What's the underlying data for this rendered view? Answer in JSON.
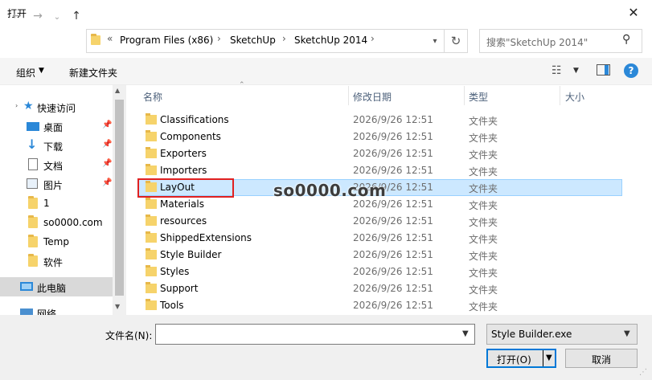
{
  "window": {
    "title": "打开",
    "close_label": "✕"
  },
  "nav": {
    "back": "←",
    "forward": "→",
    "recent": "⌄",
    "up": "↑",
    "breadcrumb_overflow": "«",
    "breadcrumbs": [
      "Program Files (x86)",
      "SketchUp",
      "SketchUp 2014"
    ],
    "sep": "›",
    "refresh": "↻",
    "search_placeholder": "搜索\"SketchUp 2014\""
  },
  "toolbar": {
    "organize": "组织",
    "new_folder": "新建文件夹"
  },
  "sidebar": {
    "items": [
      {
        "label": "快速访问",
        "icon": "star-icon"
      },
      {
        "label": "桌面",
        "icon": "desktop-icon",
        "pinned": true
      },
      {
        "label": "下载",
        "icon": "download-icon",
        "pinned": true
      },
      {
        "label": "文档",
        "icon": "document-icon",
        "pinned": true
      },
      {
        "label": "图片",
        "icon": "picture-icon",
        "pinned": true
      },
      {
        "label": "1",
        "icon": "folder-icon"
      },
      {
        "label": "so0000.com",
        "icon": "folder-icon"
      },
      {
        "label": "Temp",
        "icon": "folder-icon"
      },
      {
        "label": "软件",
        "icon": "folder-icon"
      },
      {
        "label": "此电脑",
        "icon": "computer-icon"
      },
      {
        "label": "网络",
        "icon": "network-icon"
      }
    ]
  },
  "columns": {
    "name": "名称",
    "date": "修改日期",
    "type": "类型",
    "size": "大小"
  },
  "files": [
    {
      "name": "Classifications",
      "date": "2026/9/26 12:51",
      "type": "文件夹"
    },
    {
      "name": "Components",
      "date": "2026/9/26 12:51",
      "type": "文件夹"
    },
    {
      "name": "Exporters",
      "date": "2026/9/26 12:51",
      "type": "文件夹"
    },
    {
      "name": "Importers",
      "date": "2026/9/26 12:51",
      "type": "文件夹"
    },
    {
      "name": "LayOut",
      "date": "2026/9/26 12:51",
      "type": "文件夹"
    },
    {
      "name": "Materials",
      "date": "2026/9/26 12:51",
      "type": "文件夹"
    },
    {
      "name": "resources",
      "date": "2026/9/26 12:51",
      "type": "文件夹"
    },
    {
      "name": "ShippedExtensions",
      "date": "2026/9/26 12:51",
      "type": "文件夹"
    },
    {
      "name": "Style Builder",
      "date": "2026/9/26 12:51",
      "type": "文件夹"
    },
    {
      "name": "Styles",
      "date": "2026/9/26 12:51",
      "type": "文件夹"
    },
    {
      "name": "Support",
      "date": "2026/9/26 12:51",
      "type": "文件夹"
    },
    {
      "name": "Tools",
      "date": "2026/9/26 12:51",
      "type": "文件夹"
    }
  ],
  "watermark": "so0000.com",
  "footer": {
    "filename_label": "文件名(N):",
    "filename_value": "",
    "filetype": "Style Builder.exe",
    "open": "打开(O)",
    "cancel": "取消"
  },
  "colors": {
    "accent": "#0078d7",
    "selection": "#cce8ff",
    "highlight_box": "#e02020"
  }
}
